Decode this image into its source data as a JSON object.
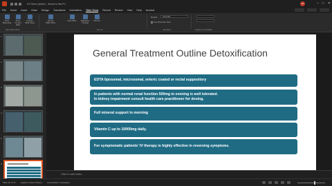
{
  "window": {
    "doc_title": "D2 Detox (slides) - Saved to this PC",
    "avatar_initials": "AA",
    "controls": [
      "–",
      "□",
      "✕"
    ]
  },
  "menu": {
    "items": [
      "File",
      "Home",
      "Insert",
      "Draw",
      "Design",
      "Transitions",
      "Animations",
      "Slide Show",
      "Record",
      "Review",
      "View",
      "Help",
      "Acrobat"
    ],
    "active_index": 7
  },
  "ribbon": {
    "buttons": [
      "From Beginning",
      "From Current Slide",
      "Custom Slide Show",
      "Set Up Slide Show",
      "Hide Slide",
      "Rehearse Timings",
      "Record"
    ],
    "group_labels": [
      "Start Slide Show",
      "Set Up",
      "Monitors",
      "Captions & Subtitles"
    ],
    "monitor_label": "Monitor:",
    "monitor_value": "Automatic",
    "presenter_view": "Use Presenter View"
  },
  "thumbnails": [
    {
      "number": "1"
    },
    {
      "number": "2"
    },
    {
      "number": "3"
    },
    {
      "number": "4"
    },
    {
      "number": "5"
    },
    {
      "number": "6"
    }
  ],
  "slide": {
    "title": "General Treatment Outline Detoxification",
    "items": [
      {
        "lines": [
          "EDTA liposomal, microsomal, enteric coated or rectal suppository"
        ]
      },
      {
        "lines": [
          "In patients with normal renal function 500mg in evening is well tolerated.",
          "In kidney impairment consult health care practitioner for dosing."
        ]
      },
      {
        "lines": [
          "Full mineral support in morning"
        ]
      },
      {
        "lines": [
          "Vitamin C up to 10000mg daily."
        ]
      },
      {
        "lines": [
          "For symptomatic patients' IV therapy is highly effective in reversing symptoms."
        ]
      }
    ],
    "box_color": "#1f6b84"
  },
  "notes": {
    "placeholder": "Click to add notes"
  },
  "status": {
    "slide_counter": "Slide 46 of 78",
    "language": "English (United States)",
    "accessibility": "Accessibility: Investigate"
  },
  "colors": {
    "accent": "#d9531e",
    "chrome": "#1f1f1f"
  }
}
